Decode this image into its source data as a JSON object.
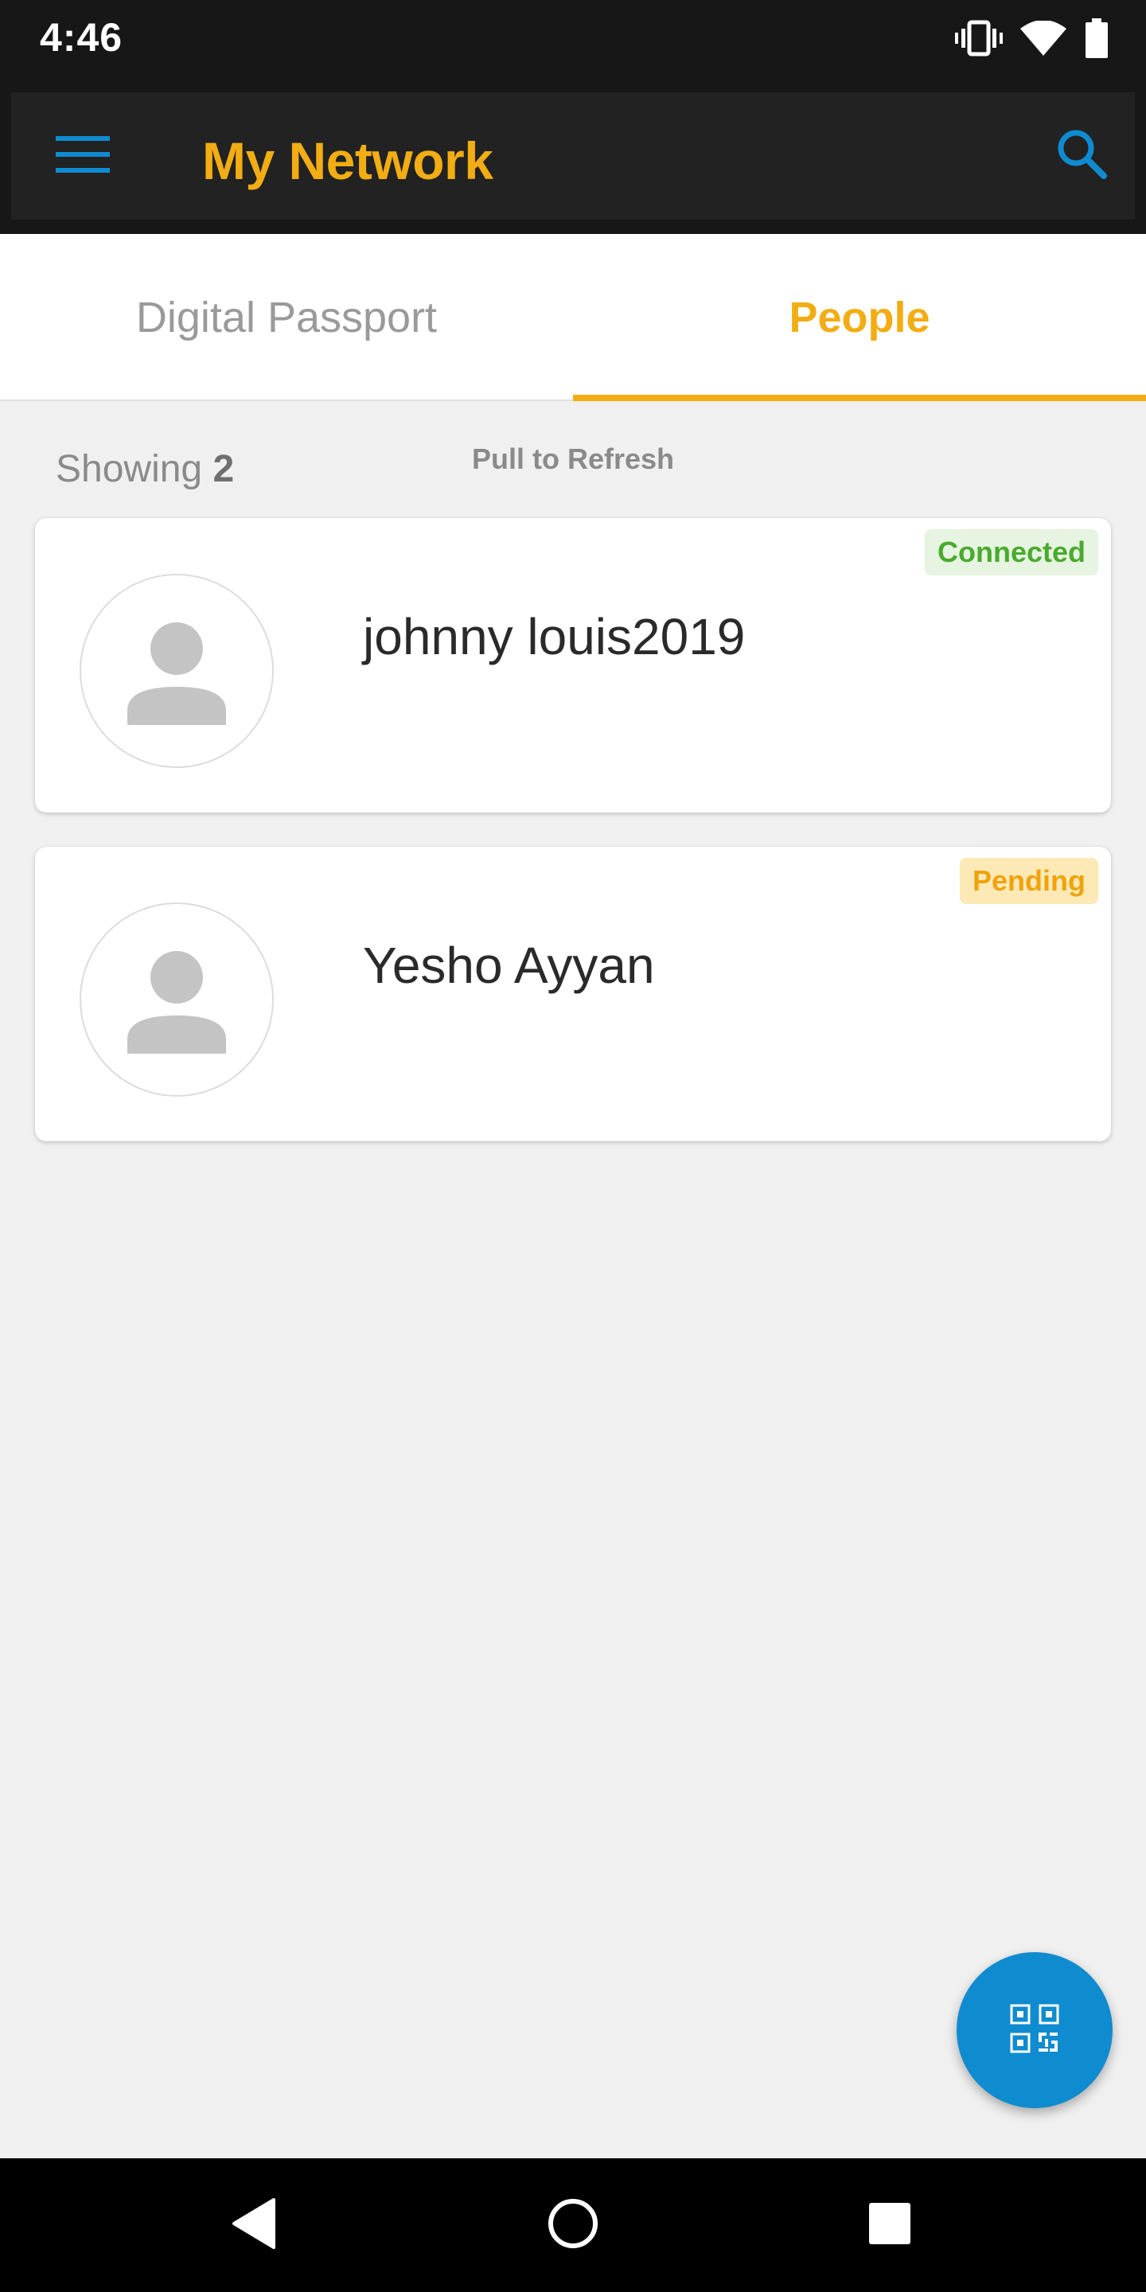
{
  "status_bar": {
    "time": "4:46",
    "icons": [
      "vibrate-icon",
      "wifi-icon",
      "battery-icon"
    ]
  },
  "app_bar": {
    "title": "My Network",
    "menu_icon": "hamburger-menu-icon",
    "search_icon": "search-icon"
  },
  "tabs": [
    {
      "label": "Digital Passport",
      "selected": false
    },
    {
      "label": "People",
      "selected": true
    }
  ],
  "list_header": {
    "showing_label": "Showing",
    "showing_count": "2",
    "pull_to_refresh": "Pull to Refresh"
  },
  "people": [
    {
      "name": "johnny louis2019",
      "status": "Connected"
    },
    {
      "name": "Yesho Ayyan",
      "status": "Pending"
    }
  ],
  "fab": {
    "icon": "qr-code-icon"
  },
  "nav_bar": {
    "icons": [
      "back-icon",
      "home-icon",
      "recents-icon"
    ]
  },
  "colors": {
    "accent_yellow": "#f2ad14",
    "accent_blue": "#0f8bd0",
    "connected_green": "#4aaa2e",
    "pending_orange": "#f0a30c",
    "app_bar_bg": "#222222",
    "page_bg": "#f0f0f0"
  }
}
